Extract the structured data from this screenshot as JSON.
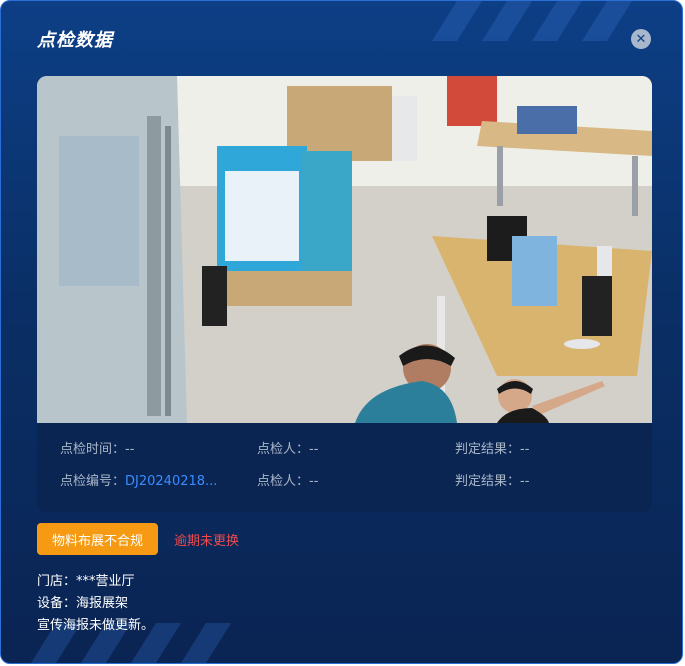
{
  "dialog": {
    "title": "点检数据",
    "close_icon": "close-icon"
  },
  "image": {
    "description_icon": "camera-snapshot"
  },
  "info": {
    "row1": [
      {
        "label": "点检时间：",
        "value": "--"
      },
      {
        "label": "点检人：",
        "value": "--"
      },
      {
        "label": "判定结果：",
        "value": "--"
      }
    ],
    "row2": [
      {
        "label": "点检编号：",
        "value": "DJ20240218..."
      },
      {
        "label": "点检人：",
        "value": "--"
      },
      {
        "label": "判定结果：",
        "value": "--"
      }
    ]
  },
  "tags": {
    "warning": "物料布展不合规",
    "overdue": "逾期未更换"
  },
  "details": {
    "store": "门店：***营业厅",
    "device": "设备：海报展架",
    "note": "宣传海报未做更新。"
  },
  "colors": {
    "accent_blue": "#3b8cff",
    "warning_orange": "#f59a12",
    "alert_red": "#f04b4b"
  }
}
